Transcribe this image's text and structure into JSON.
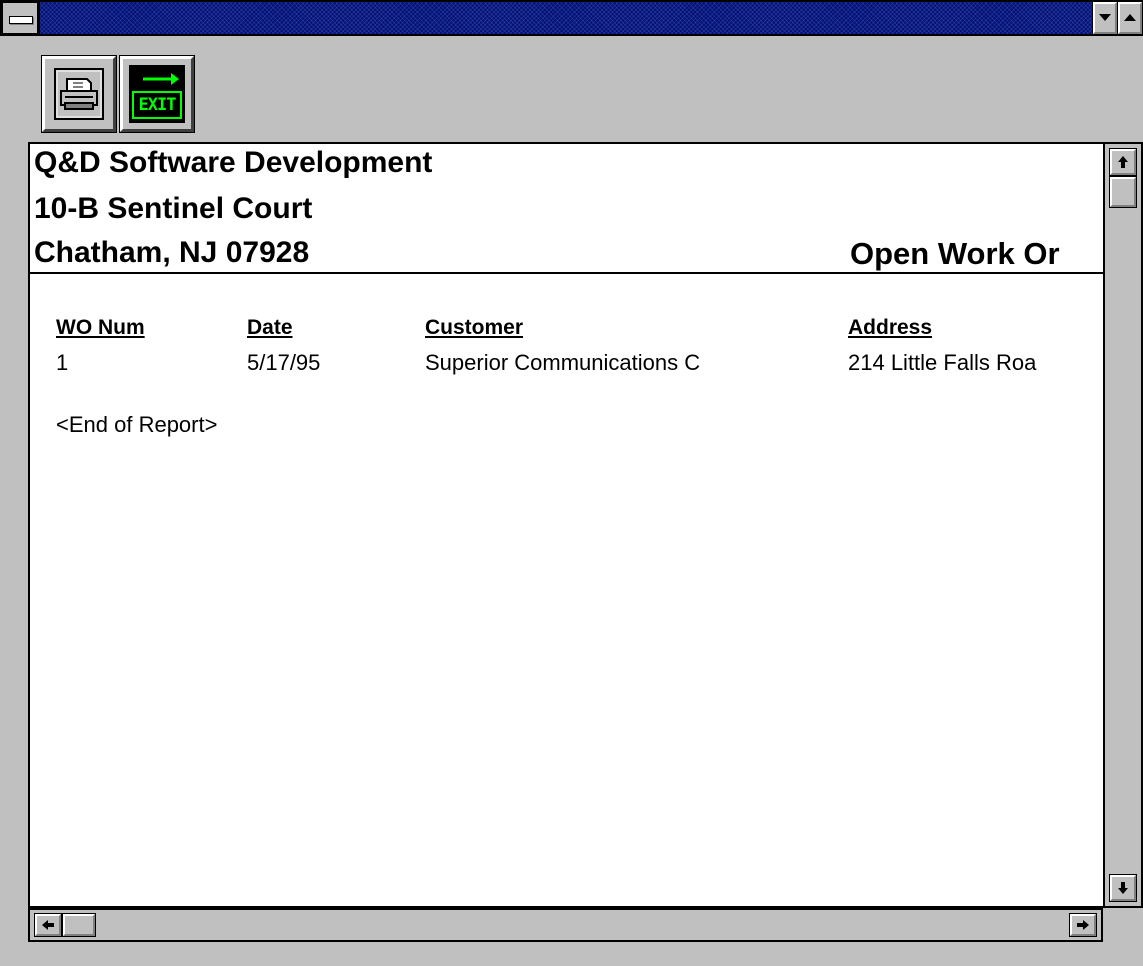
{
  "window": {
    "title": "",
    "controls": {
      "system_menu_icon": "system-menu-bar-icon",
      "minimize_icon": "triangle-down-icon",
      "maximize_icon": "triangle-up-icon"
    }
  },
  "toolbar": {
    "print_icon": "printer-icon",
    "exit_icon": "exit-sign-icon",
    "exit_label": "EXIT"
  },
  "report": {
    "company": "Q&D Software Development",
    "street": "10-B Sentinel Court",
    "city": "Chatham, NJ 07928",
    "title": "Open Work Or",
    "columns": [
      "WO Num",
      "Date",
      "Customer",
      "Address"
    ],
    "rows": [
      [
        "1",
        "5/17/95",
        "Superior Communications C",
        "214 Little Falls Roa"
      ]
    ],
    "end_text": "<End of Report>"
  },
  "scrollbars": {
    "vertical_position": 0,
    "horizontal_position": 0
  },
  "colors": {
    "titlebar": "#00107a",
    "face": "#c0c0c0",
    "exit_green": "#00ff00"
  }
}
